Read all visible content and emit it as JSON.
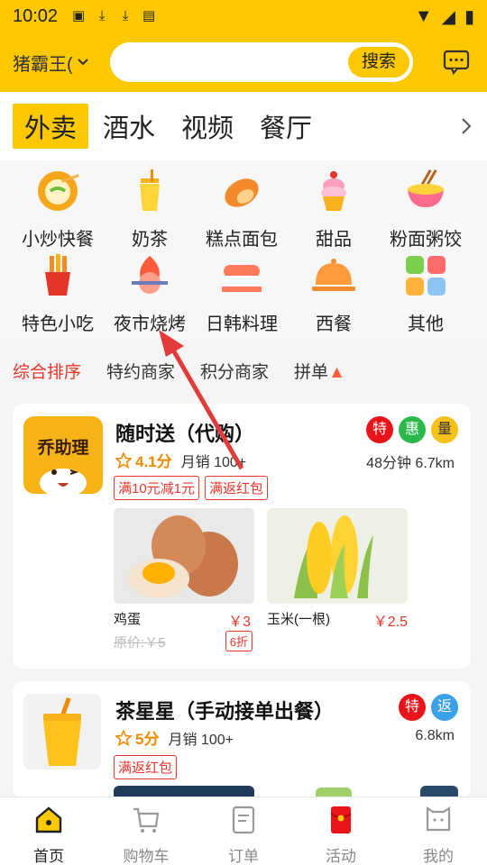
{
  "status": {
    "time": "10:02"
  },
  "header": {
    "location": "猪霸王(",
    "search_placeholder": "",
    "search_button": "搜索"
  },
  "tabs": {
    "items": [
      "外卖",
      "酒水",
      "视频",
      "餐厅"
    ],
    "active": "外卖"
  },
  "categories": [
    {
      "label": "小炒快餐",
      "icon": "stir-fry-icon"
    },
    {
      "label": "奶茶",
      "icon": "milk-tea-icon"
    },
    {
      "label": "糕点面包",
      "icon": "bread-icon"
    },
    {
      "label": "甜品",
      "icon": "dessert-icon"
    },
    {
      "label": "粉面粥饺",
      "icon": "noodle-bowl-icon"
    },
    {
      "label": "特色小吃",
      "icon": "snack-icon"
    },
    {
      "label": "夜市烧烤",
      "icon": "bbq-icon"
    },
    {
      "label": "日韩料理",
      "icon": "sushi-icon"
    },
    {
      "label": "西餐",
      "icon": "cloche-icon"
    },
    {
      "label": "其他",
      "icon": "grid-icon"
    }
  ],
  "sort": {
    "items": [
      "综合排序",
      "特约商家",
      "积分商家",
      "拼单"
    ],
    "active": "综合排序"
  },
  "shops": [
    {
      "logo_text": "乔助理",
      "name": "随时送（代购）",
      "score": "4.1分",
      "sales": "月销 100+",
      "time_distance": "48分钟 6.7km",
      "badges": [
        "特",
        "惠",
        "量"
      ],
      "promos": [
        "满10元减1元",
        "满返红包"
      ],
      "products": [
        {
          "name": "鸡蛋",
          "price": "￥3",
          "original": "原价:￥5",
          "discount": "6折"
        },
        {
          "name": "玉米(一根)",
          "price": "￥2.5"
        }
      ]
    },
    {
      "name": "茶星星（手动接单出餐）",
      "score": "5分",
      "sales": "月销 100+",
      "distance": "6.8km",
      "badges": [
        "特",
        "返"
      ],
      "promos": [
        "满返红包"
      ]
    }
  ],
  "bottom_nav": [
    {
      "label": "首页",
      "icon": "home-icon"
    },
    {
      "label": "购物车",
      "icon": "cart-icon"
    },
    {
      "label": "订单",
      "icon": "order-icon"
    },
    {
      "label": "活动",
      "icon": "red-envelope-icon"
    },
    {
      "label": "我的",
      "icon": "profile-icon"
    }
  ],
  "colors": {
    "brand_yellow": "#fcc800",
    "accent_red": "#e8352a",
    "badge_green": "#2db84c",
    "badge_blue": "#3aa0e8",
    "star_orange": "#f08a00"
  }
}
